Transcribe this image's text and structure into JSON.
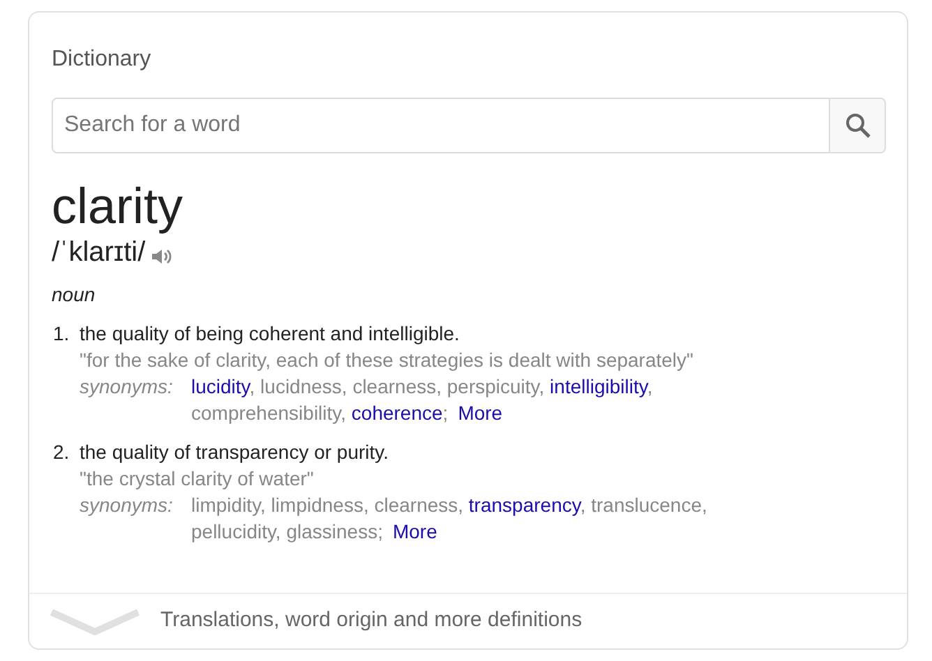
{
  "card": {
    "title": "Dictionary",
    "search": {
      "placeholder": "Search for a word"
    },
    "word": "clarity",
    "pronunciation": "/ˈklarɪti/",
    "part_of_speech": "noun",
    "senses": [
      {
        "number": "1.",
        "definition": "the quality of being coherent and intelligible.",
        "example": "\"for the sake of clarity, each of these strategies is dealt with separately\"",
        "synonyms_label": "synonyms:",
        "synonyms": [
          {
            "text": "lucidity",
            "link": true
          },
          {
            "text": ", lucidness, clearness, perspicuity, ",
            "link": false
          },
          {
            "text": "intelligibility",
            "link": true
          },
          {
            "text": ", ",
            "link": false
          },
          {
            "text": "comprehensibility, ",
            "link": false
          },
          {
            "text": "coherence",
            "link": true
          },
          {
            "text": ";",
            "link": false
          }
        ],
        "more": "More"
      },
      {
        "number": "2.",
        "definition": "the quality of transparency or purity.",
        "example": "\"the crystal clarity of water\"",
        "synonyms_label": "synonyms:",
        "synonyms": [
          {
            "text": "limpidity, limpidness, clearness, ",
            "link": false
          },
          {
            "text": "transparency",
            "link": true
          },
          {
            "text": ", translucence, ",
            "link": false
          },
          {
            "text": "pellucidity, glassiness;",
            "link": false
          }
        ],
        "more": "More"
      }
    ],
    "footer": "Translations, word origin and more definitions"
  }
}
